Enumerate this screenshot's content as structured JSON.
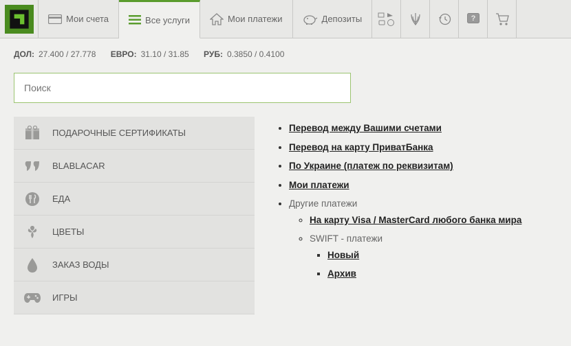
{
  "nav": {
    "accounts": "Мои счета",
    "services": "Все услуги",
    "payments": "Мои платежи",
    "deposits": "Депозиты"
  },
  "rates": {
    "usd_label": "ДОЛ:",
    "usd": "27.400 / 27.778",
    "eur_label": "ЕВРО:",
    "eur": "31.10 / 31.85",
    "rub_label": "РУБ:",
    "rub": "0.3850 / 0.4100"
  },
  "search": {
    "placeholder": "Поиск"
  },
  "categories": [
    "ПОДАРОЧНЫЕ СЕРТИФИКАТЫ",
    "BLABLACAR",
    "ЕДА",
    "ЦВЕТЫ",
    "ЗАКАЗ ВОДЫ",
    "ИГРЫ"
  ],
  "links": {
    "l1": "Перевод между Вашими счетами",
    "l2": "Перевод на карту ПриватБанка",
    "l3": "По Украине (платеж по реквизитам)",
    "l4": "Мои платежи",
    "l5": "Другие платежи",
    "l6": "На карту Visa / MasterCard любого банка мира",
    "l7": "SWIFT - платежи",
    "l8": "Новый",
    "l9": "Архив"
  }
}
